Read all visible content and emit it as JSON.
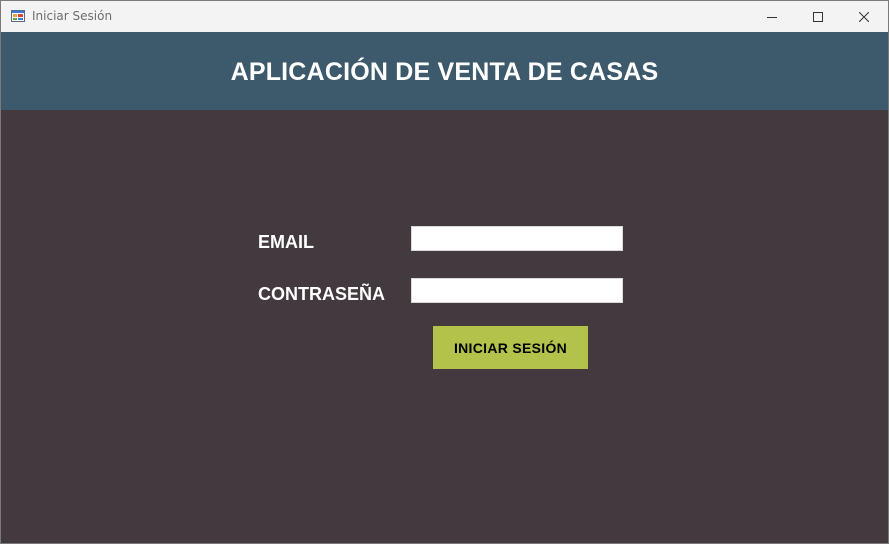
{
  "window": {
    "title": "Iniciar Sesión",
    "icons": {
      "app": "windows-form-icon",
      "minimize": "minimize-icon",
      "maximize": "maximize-icon",
      "close": "close-icon"
    }
  },
  "header": {
    "title": "APLICACIÓN DE VENTA DE CASAS"
  },
  "form": {
    "email_label": "EMAIL",
    "email_value": "",
    "password_label": "CONTRASEÑA",
    "password_value": "",
    "login_button": "INICIAR SESIÓN"
  },
  "colors": {
    "header_bg": "#3d5a6c",
    "body_bg": "#433a3f",
    "button_bg": "#b2c24a"
  }
}
